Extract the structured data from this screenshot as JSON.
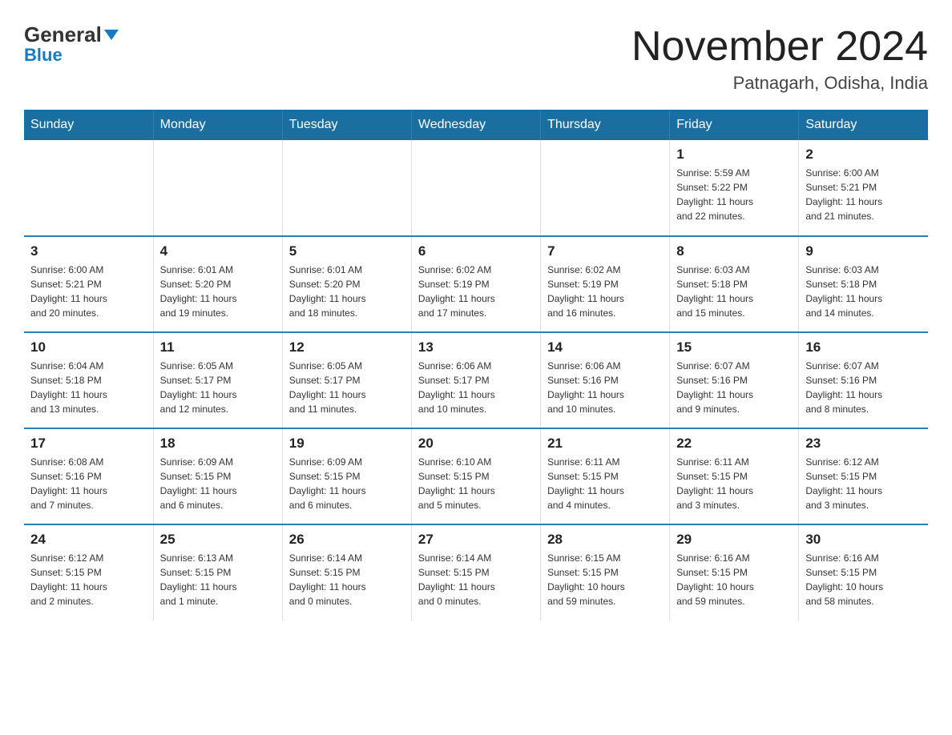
{
  "header": {
    "logo": {
      "general": "General",
      "blue": "Blue"
    },
    "month_title": "November 2024",
    "location": "Patnagarh, Odisha, India"
  },
  "weekdays": [
    "Sunday",
    "Monday",
    "Tuesday",
    "Wednesday",
    "Thursday",
    "Friday",
    "Saturday"
  ],
  "weeks": [
    [
      {
        "day": "",
        "info": ""
      },
      {
        "day": "",
        "info": ""
      },
      {
        "day": "",
        "info": ""
      },
      {
        "day": "",
        "info": ""
      },
      {
        "day": "",
        "info": ""
      },
      {
        "day": "1",
        "info": "Sunrise: 5:59 AM\nSunset: 5:22 PM\nDaylight: 11 hours\nand 22 minutes."
      },
      {
        "day": "2",
        "info": "Sunrise: 6:00 AM\nSunset: 5:21 PM\nDaylight: 11 hours\nand 21 minutes."
      }
    ],
    [
      {
        "day": "3",
        "info": "Sunrise: 6:00 AM\nSunset: 5:21 PM\nDaylight: 11 hours\nand 20 minutes."
      },
      {
        "day": "4",
        "info": "Sunrise: 6:01 AM\nSunset: 5:20 PM\nDaylight: 11 hours\nand 19 minutes."
      },
      {
        "day": "5",
        "info": "Sunrise: 6:01 AM\nSunset: 5:20 PM\nDaylight: 11 hours\nand 18 minutes."
      },
      {
        "day": "6",
        "info": "Sunrise: 6:02 AM\nSunset: 5:19 PM\nDaylight: 11 hours\nand 17 minutes."
      },
      {
        "day": "7",
        "info": "Sunrise: 6:02 AM\nSunset: 5:19 PM\nDaylight: 11 hours\nand 16 minutes."
      },
      {
        "day": "8",
        "info": "Sunrise: 6:03 AM\nSunset: 5:18 PM\nDaylight: 11 hours\nand 15 minutes."
      },
      {
        "day": "9",
        "info": "Sunrise: 6:03 AM\nSunset: 5:18 PM\nDaylight: 11 hours\nand 14 minutes."
      }
    ],
    [
      {
        "day": "10",
        "info": "Sunrise: 6:04 AM\nSunset: 5:18 PM\nDaylight: 11 hours\nand 13 minutes."
      },
      {
        "day": "11",
        "info": "Sunrise: 6:05 AM\nSunset: 5:17 PM\nDaylight: 11 hours\nand 12 minutes."
      },
      {
        "day": "12",
        "info": "Sunrise: 6:05 AM\nSunset: 5:17 PM\nDaylight: 11 hours\nand 11 minutes."
      },
      {
        "day": "13",
        "info": "Sunrise: 6:06 AM\nSunset: 5:17 PM\nDaylight: 11 hours\nand 10 minutes."
      },
      {
        "day": "14",
        "info": "Sunrise: 6:06 AM\nSunset: 5:16 PM\nDaylight: 11 hours\nand 10 minutes."
      },
      {
        "day": "15",
        "info": "Sunrise: 6:07 AM\nSunset: 5:16 PM\nDaylight: 11 hours\nand 9 minutes."
      },
      {
        "day": "16",
        "info": "Sunrise: 6:07 AM\nSunset: 5:16 PM\nDaylight: 11 hours\nand 8 minutes."
      }
    ],
    [
      {
        "day": "17",
        "info": "Sunrise: 6:08 AM\nSunset: 5:16 PM\nDaylight: 11 hours\nand 7 minutes."
      },
      {
        "day": "18",
        "info": "Sunrise: 6:09 AM\nSunset: 5:15 PM\nDaylight: 11 hours\nand 6 minutes."
      },
      {
        "day": "19",
        "info": "Sunrise: 6:09 AM\nSunset: 5:15 PM\nDaylight: 11 hours\nand 6 minutes."
      },
      {
        "day": "20",
        "info": "Sunrise: 6:10 AM\nSunset: 5:15 PM\nDaylight: 11 hours\nand 5 minutes."
      },
      {
        "day": "21",
        "info": "Sunrise: 6:11 AM\nSunset: 5:15 PM\nDaylight: 11 hours\nand 4 minutes."
      },
      {
        "day": "22",
        "info": "Sunrise: 6:11 AM\nSunset: 5:15 PM\nDaylight: 11 hours\nand 3 minutes."
      },
      {
        "day": "23",
        "info": "Sunrise: 6:12 AM\nSunset: 5:15 PM\nDaylight: 11 hours\nand 3 minutes."
      }
    ],
    [
      {
        "day": "24",
        "info": "Sunrise: 6:12 AM\nSunset: 5:15 PM\nDaylight: 11 hours\nand 2 minutes."
      },
      {
        "day": "25",
        "info": "Sunrise: 6:13 AM\nSunset: 5:15 PM\nDaylight: 11 hours\nand 1 minute."
      },
      {
        "day": "26",
        "info": "Sunrise: 6:14 AM\nSunset: 5:15 PM\nDaylight: 11 hours\nand 0 minutes."
      },
      {
        "day": "27",
        "info": "Sunrise: 6:14 AM\nSunset: 5:15 PM\nDaylight: 11 hours\nand 0 minutes."
      },
      {
        "day": "28",
        "info": "Sunrise: 6:15 AM\nSunset: 5:15 PM\nDaylight: 10 hours\nand 59 minutes."
      },
      {
        "day": "29",
        "info": "Sunrise: 6:16 AM\nSunset: 5:15 PM\nDaylight: 10 hours\nand 59 minutes."
      },
      {
        "day": "30",
        "info": "Sunrise: 6:16 AM\nSunset: 5:15 PM\nDaylight: 10 hours\nand 58 minutes."
      }
    ]
  ]
}
